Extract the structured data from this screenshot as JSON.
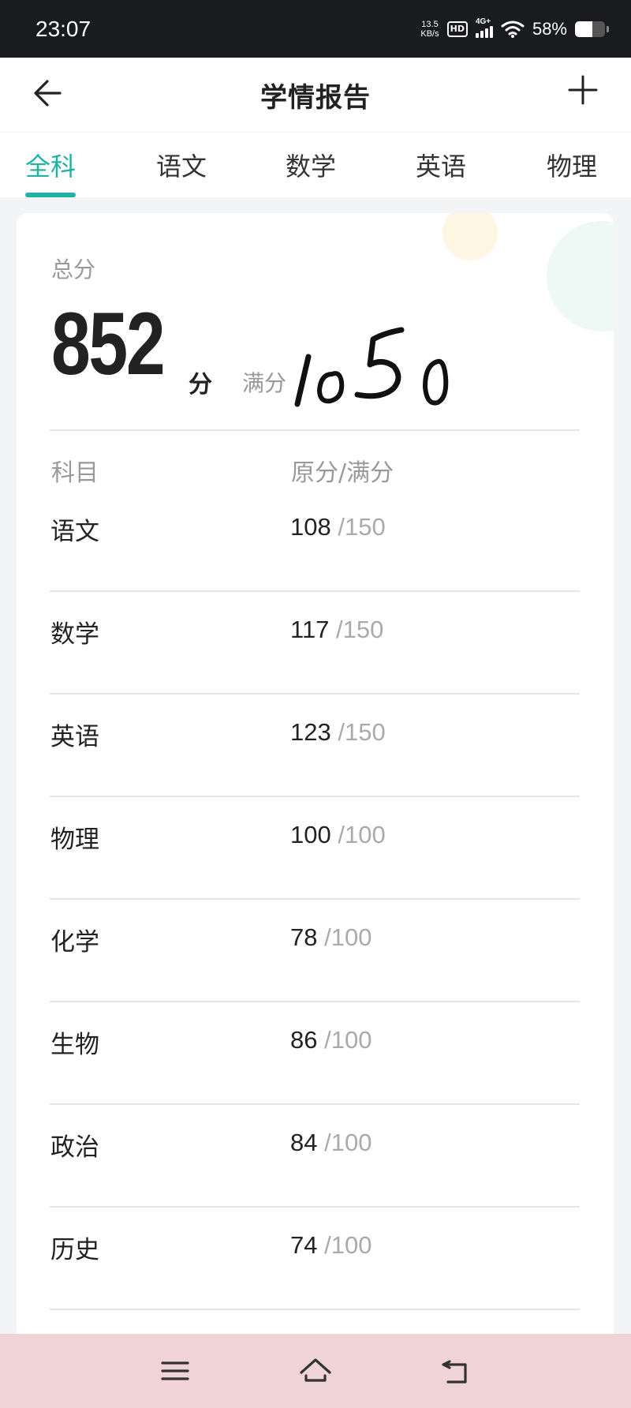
{
  "status_bar": {
    "time": "23:07",
    "net_speed_value": "13.5",
    "net_speed_unit": "KB/s",
    "hd_badge": "HD",
    "network_label": "4G+",
    "battery_percent": "58%",
    "battery_level": 0.58
  },
  "header": {
    "title": "学情报告",
    "back_icon": "arrow-left-icon",
    "add_icon": "plus-icon"
  },
  "tabs": [
    {
      "label": "全科",
      "active": true
    },
    {
      "label": "语文",
      "active": false
    },
    {
      "label": "数学",
      "active": false
    },
    {
      "label": "英语",
      "active": false
    },
    {
      "label": "物理",
      "active": false
    }
  ],
  "summary": {
    "total_label": "总分",
    "total_score": "852",
    "unit": "分",
    "full_label": "满分",
    "handwritten_full_score": "1050"
  },
  "table": {
    "col_subject": "科目",
    "col_score": "原分/满分",
    "rows": [
      {
        "subject": "语文",
        "score": "108",
        "max": "/150"
      },
      {
        "subject": "数学",
        "score": "117",
        "max": "/150"
      },
      {
        "subject": "英语",
        "score": "123",
        "max": "/150"
      },
      {
        "subject": "物理",
        "score": "100",
        "max": "/100"
      },
      {
        "subject": "化学",
        "score": "78",
        "max": "/100"
      },
      {
        "subject": "生物",
        "score": "86",
        "max": "/100"
      },
      {
        "subject": "政治",
        "score": "84",
        "max": "/100"
      },
      {
        "subject": "历史",
        "score": "74",
        "max": "/100"
      }
    ]
  },
  "nav_bar": {
    "menu_icon": "menu-icon",
    "home_icon": "home-icon",
    "back_icon": "return-icon"
  },
  "colors": {
    "accent": "#20b2a2",
    "nav_bar_bg": "#f0d3d6",
    "status_bar_bg": "#1a1b1e"
  }
}
